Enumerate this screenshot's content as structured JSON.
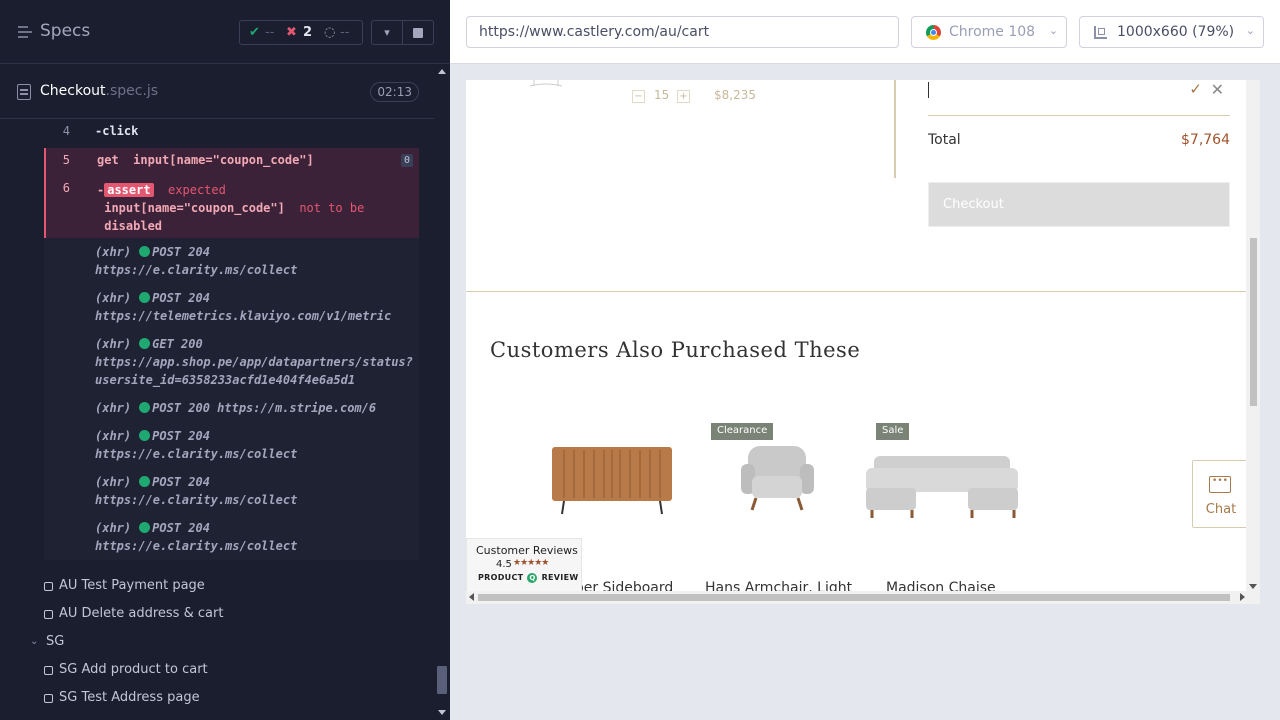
{
  "runner": {
    "title": "Specs",
    "stats": {
      "passed": "--",
      "failed": "2",
      "pending": "--"
    },
    "spec": {
      "name": "Checkout",
      "ext": ".spec.js",
      "time": "02:13"
    },
    "commands": [
      {
        "num": "4",
        "text": "-click"
      },
      {
        "num": "5",
        "name": "get",
        "selector": "input[name=\"coupon_code\"]",
        "pin": "0"
      },
      {
        "num": "6",
        "prefix": "-",
        "tag": "assert",
        "word": "expected",
        "selector": "input[name=\"coupon_code\"]",
        "phrase": "not to be",
        "last": "disabled"
      }
    ],
    "xhr": [
      {
        "kind": "(xhr)",
        "line1": "POST 204",
        "line2": "https://e.clarity.ms/collect"
      },
      {
        "kind": "(xhr)",
        "line1": "POST 204",
        "line2": "https://telemetrics.klaviyo.com/v1/metric"
      },
      {
        "kind": "(xhr)",
        "line1": "GET 200",
        "line2": "https://app.shop.pe/app/datapartners/status?",
        "line3": "usersite_id=6358233acfd1e404f4e6a5d1"
      },
      {
        "kind": "(xhr)",
        "line1": "POST 200 https://m.stripe.com/6"
      },
      {
        "kind": "(xhr)",
        "line1": "POST 204",
        "line2": "https://e.clarity.ms/collect"
      },
      {
        "kind": "(xhr)",
        "line1": "POST 204",
        "line2": "https://e.clarity.ms/collect"
      },
      {
        "kind": "(xhr)",
        "line1": "POST 204",
        "line2": "https://e.clarity.ms/collect"
      }
    ],
    "tests": [
      "AU Test Payment page",
      "AU Delete address & cart"
    ],
    "suite": "SG",
    "suite_tests": [
      "SG Add product to cart",
      "SG Test Address page"
    ]
  },
  "aut": {
    "url": "https://www.castlery.com/au/cart",
    "browser": "Chrome 108",
    "viewport": "1000x660 (79%)",
    "cart": {
      "qty": "15",
      "item_price": "$8,235",
      "total_label": "Total",
      "total_value": "$7,764",
      "checkout_label": "Checkout"
    },
    "section_title": "Customers Also Purchased These",
    "products": [
      {
        "name": "Harper Sideboard",
        "badge": ""
      },
      {
        "name": "Hans Armchair, Light",
        "badge": "Clearance"
      },
      {
        "name": "Madison Chaise",
        "badge": "Sale"
      }
    ],
    "reviews": {
      "title": "Customer Reviews",
      "score": "4.5",
      "stars": "★★★★★",
      "brand_left": "PRODUCT",
      "brand_mid": "Q",
      "brand_right": "REVIEW"
    },
    "chat_label": "Chat",
    "chat_icon": "•••"
  }
}
